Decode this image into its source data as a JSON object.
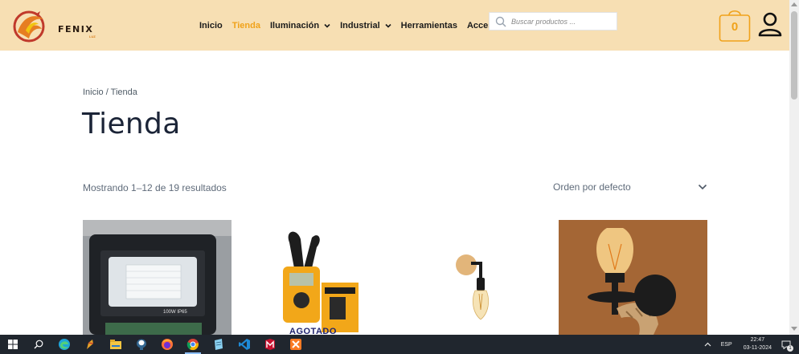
{
  "brand": {
    "name": "FENIX",
    "tagline": "LUZ"
  },
  "nav": {
    "items": [
      {
        "label": "Inicio",
        "active": false,
        "dropdown": false
      },
      {
        "label": "Tienda",
        "active": true,
        "dropdown": false
      },
      {
        "label": "Iluminación",
        "active": false,
        "dropdown": true
      },
      {
        "label": "Industrial",
        "active": false,
        "dropdown": true
      },
      {
        "label": "Herramientas",
        "active": false,
        "dropdown": false
      },
      {
        "label": "Accesorios",
        "active": false,
        "dropdown": false
      }
    ]
  },
  "search": {
    "placeholder": "Buscar productos ...",
    "value": ""
  },
  "cart": {
    "count": "0"
  },
  "breadcrumb": {
    "home": "Inicio",
    "separator": "/",
    "current": "Tienda"
  },
  "page": {
    "title": "Tienda"
  },
  "shop": {
    "results": "Mostrando 1–12 de 19 resultados",
    "orderby": "Orden por defecto"
  },
  "products": [
    {
      "image": "floodlight-photo",
      "image_text": "100W IP65",
      "badge": ""
    },
    {
      "image": "ingco-clamp-meter",
      "image_text": "",
      "badge": "AGOTADO"
    },
    {
      "image": "wall-lamp-edison-bulb",
      "image_text": "",
      "badge": ""
    },
    {
      "image": "rope-wall-lamp-photo",
      "image_text": "",
      "badge": ""
    }
  ],
  "taskbar": {
    "apps": [
      "windows-start-icon",
      "search-icon",
      "edge-icon",
      "pen-icon",
      "file-explorer-icon",
      "pgadmin-icon",
      "firefox-icon",
      "chrome-icon",
      "notepad-icon",
      "vscode-icon",
      "mcafee-icon",
      "xampp-icon"
    ],
    "language": "ESP",
    "time": "22:47",
    "date": "03-11-2024",
    "notifications": "1"
  },
  "colors": {
    "header_bg": "#f7dfb3",
    "accent": "#f0a21a",
    "title": "#1b2437",
    "taskbar": "#20262e"
  }
}
